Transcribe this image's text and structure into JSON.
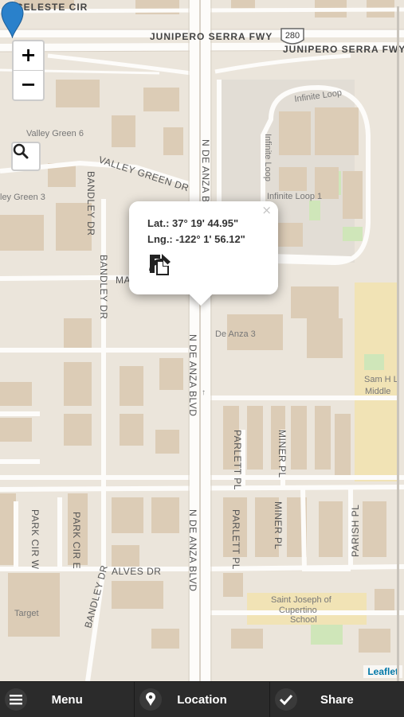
{
  "map": {
    "street_labels": {
      "celeste": "CELESTE CIR",
      "junipero_1": "JUNIPERO SERRA FWY",
      "junipero_2": "JUNIPERO SERRA FWY",
      "highway_shield": "280",
      "infinite_loop": "Infinite Loop",
      "infinite_loop_v": "Infinite Loop",
      "infinite_loop_1": "Infinite Loop 1",
      "valley_green_6": "Valley Green 6",
      "valley_green_dr": "VALLEY GREEN DR",
      "valley_green_3": "ley Green 3",
      "bandley_1": "BANDLEY DR",
      "bandley_2": "BANDLEY DR",
      "bandley_3": "BANDLEY DR",
      "de_anza_top": "N DE ANZA BLVD",
      "de_anza_mid": "N DE ANZA BLVD",
      "de_anza_bottom": "N DE ANZA BLVD",
      "mariani": "MA",
      "de_anza_3": "De Anza 3",
      "sam_h_1": "Sam H L",
      "sam_h_2": "Middle",
      "parlett_1": "PARLETT PL",
      "parlett_2": "PARLETT PL",
      "miner_1": "MINER PL",
      "miner_2": "MINER PL",
      "parish": "PARISH PL",
      "park_cir_w": "PARK CIR W",
      "park_cir_e": "PARK CIR E",
      "alves": "ALVES DR",
      "target": "Target",
      "saint_joseph_1": "Saint Joseph of",
      "saint_joseph_2": "Cupertino",
      "saint_joseph_3": "School"
    },
    "zoom_in": "+",
    "zoom_out": "−",
    "attribution": "Leaflet"
  },
  "popup": {
    "lat": "Lat.: 37° 19' 44.95\"",
    "lng": "Lng.: -122° 1' 56.12\"",
    "close": "×"
  },
  "bottom_bar": {
    "menu": "Menu",
    "location": "Location",
    "share": "Share"
  },
  "icons": [
    "menu-icon",
    "map-pin-icon",
    "check-icon",
    "share-arrow-icon",
    "copy-icon",
    "search-icon"
  ],
  "colors": {
    "marker": "#2a81cb",
    "bar": "#2b2b2b"
  }
}
